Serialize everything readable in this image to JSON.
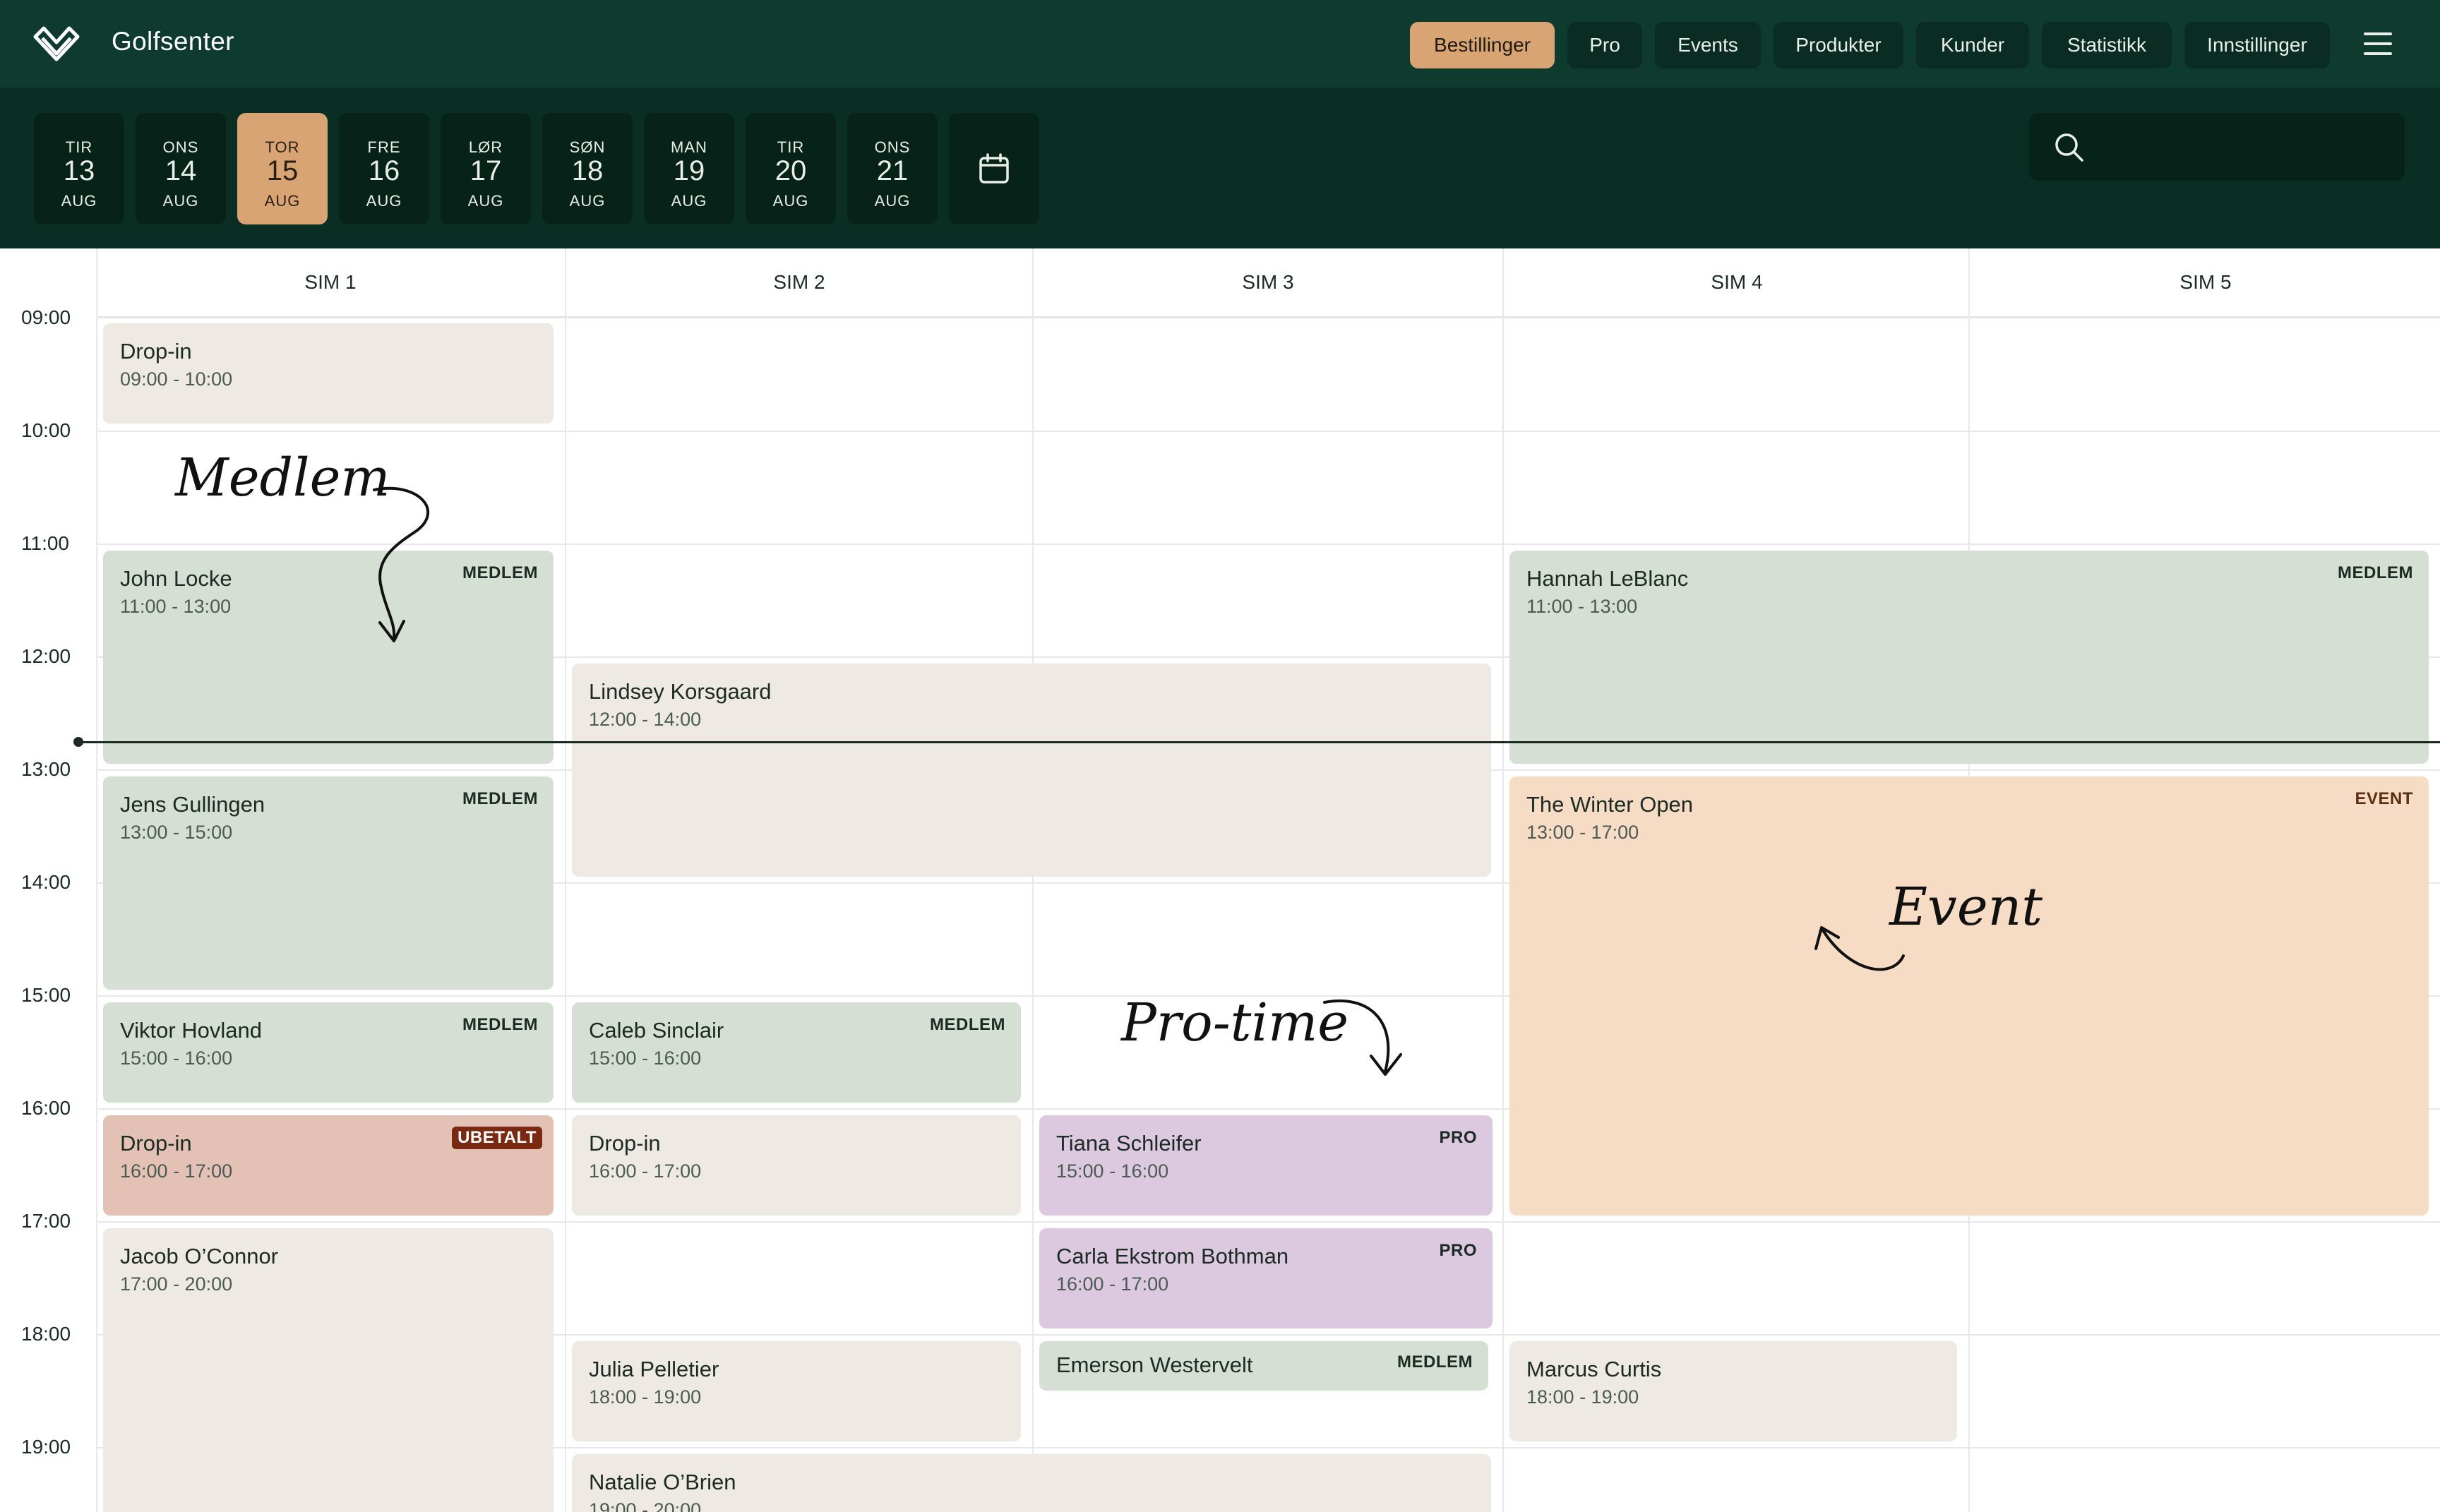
{
  "app": {
    "title": "Golfsenter"
  },
  "nav": {
    "items": [
      {
        "label": "Bestillinger",
        "active": true
      },
      {
        "label": "Pro",
        "active": false
      },
      {
        "label": "Events",
        "active": false
      },
      {
        "label": "Produkter",
        "active": false
      },
      {
        "label": "Kunder",
        "active": false
      },
      {
        "label": "Statistikk",
        "active": false
      },
      {
        "label": "Innstillinger",
        "active": false
      }
    ]
  },
  "dates": [
    {
      "dow": "TIR",
      "day": "13",
      "month": "AUG",
      "active": false
    },
    {
      "dow": "ONS",
      "day": "14",
      "month": "AUG",
      "active": false
    },
    {
      "dow": "TOR",
      "day": "15",
      "month": "AUG",
      "active": true
    },
    {
      "dow": "FRE",
      "day": "16",
      "month": "AUG",
      "active": false
    },
    {
      "dow": "LØR",
      "day": "17",
      "month": "AUG",
      "active": false
    },
    {
      "dow": "SØN",
      "day": "18",
      "month": "AUG",
      "active": false
    },
    {
      "dow": "MAN",
      "day": "19",
      "month": "AUG",
      "active": false
    },
    {
      "dow": "TIR",
      "day": "20",
      "month": "AUG",
      "active": false
    },
    {
      "dow": "ONS",
      "day": "21",
      "month": "AUG",
      "active": false
    }
  ],
  "search": {
    "placeholder": "",
    "icon": "search-icon"
  },
  "columns": [
    "SIM 1",
    "SIM 2",
    "SIM 3",
    "SIM 4",
    "SIM 5"
  ],
  "times": [
    "09:00",
    "10:00",
    "11:00",
    "12:00",
    "13:00",
    "14:00",
    "15:00",
    "16:00",
    "17:00",
    "18:00",
    "19:00"
  ],
  "bookings": [
    {
      "name": "Drop-in",
      "time": "09:00 - 10:00",
      "tag": "",
      "kind": "drop"
    },
    {
      "name": "John Locke",
      "time": "11:00 - 13:00",
      "tag": "MEDLEM",
      "kind": "mem"
    },
    {
      "name": "Jens Gullingen",
      "time": "13:00 - 15:00",
      "tag": "MEDLEM",
      "kind": "mem"
    },
    {
      "name": "Viktor Hovland",
      "time": "15:00 - 16:00",
      "tag": "MEDLEM",
      "kind": "mem"
    },
    {
      "name": "Drop-in",
      "time": "16:00 - 17:00",
      "tag": "UBETALT",
      "kind": "unpaid"
    },
    {
      "name": "Jacob O’Connor",
      "time": "17:00 - 20:00",
      "tag": "",
      "kind": "drop"
    },
    {
      "name": "Lindsey Korsgaard",
      "time": "12:00 - 14:00",
      "tag": "",
      "kind": "drop"
    },
    {
      "name": "Caleb Sinclair",
      "time": "15:00 - 16:00",
      "tag": "MEDLEM",
      "kind": "mem"
    },
    {
      "name": "Drop-in",
      "time": "16:00 - 17:00",
      "tag": "",
      "kind": "drop"
    },
    {
      "name": "Julia Pelletier",
      "time": "18:00 - 19:00",
      "tag": "",
      "kind": "drop"
    },
    {
      "name": "Natalie O’Brien",
      "time": "19:00 - 20:00",
      "tag": "",
      "kind": "drop"
    },
    {
      "name": "Tiana Schleifer",
      "time": "15:00 - 16:00",
      "tag": "PRO",
      "kind": "pro"
    },
    {
      "name": "Carla Ekstrom Bothman",
      "time": "16:00 - 17:00",
      "tag": "PRO",
      "kind": "pro"
    },
    {
      "name": "Emerson Westervelt",
      "time": "",
      "tag": "MEDLEM",
      "kind": "mem"
    },
    {
      "name": "Hannah LeBlanc",
      "time": "11:00 - 13:00",
      "tag": "MEDLEM",
      "kind": "mem"
    },
    {
      "name": "The Winter Open",
      "time": "13:00 - 17:00",
      "tag": "EVENT",
      "kind": "event"
    },
    {
      "name": "Marcus Curtis",
      "time": "18:00 - 19:00",
      "tag": "",
      "kind": "drop"
    }
  ],
  "annotations": {
    "member": "Medlem",
    "event": "Event",
    "pro": "Pro-time"
  },
  "colors": {
    "header": "#0f3a2e",
    "accent": "#d9a473",
    "member": "#d6dfd4",
    "dropin": "#eeeae3",
    "pro": "#dcc9e0",
    "event": "#f6dcc4",
    "unpaid": "#e3c1b4",
    "unpaid_badge": "#7a2a10"
  }
}
